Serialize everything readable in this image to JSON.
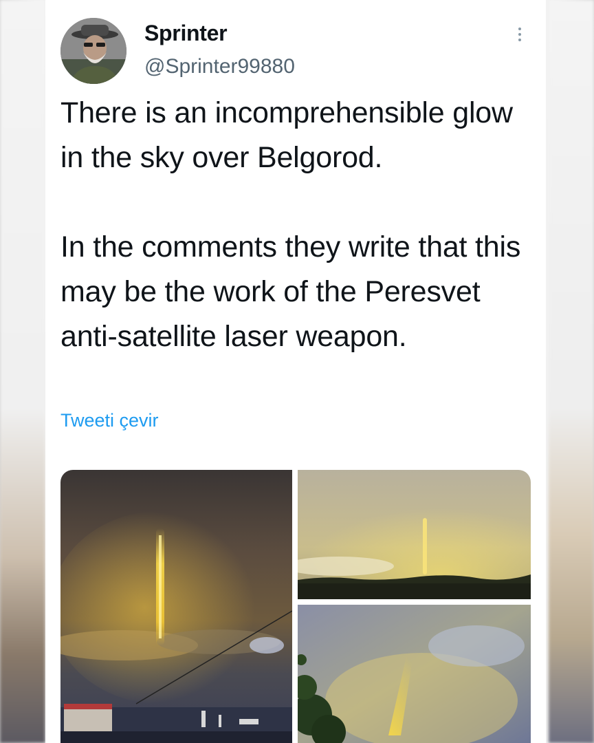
{
  "tweet": {
    "author_name": "Sprinter",
    "author_handle": "@Sprinter99880",
    "text": "There is an incomprehensible glow in the sky over Belgorod.\n\nIn the comments they write that this may be the work of the Peresvet anti-satellite laser weapon.",
    "translate_label": "Tweeti çevir"
  },
  "media": {
    "photo_count": 3
  },
  "icons": {
    "more": "more-vertical-icon"
  },
  "colors": {
    "link": "#1d9bf0",
    "text": "#0f1419",
    "secondary": "#536471"
  }
}
